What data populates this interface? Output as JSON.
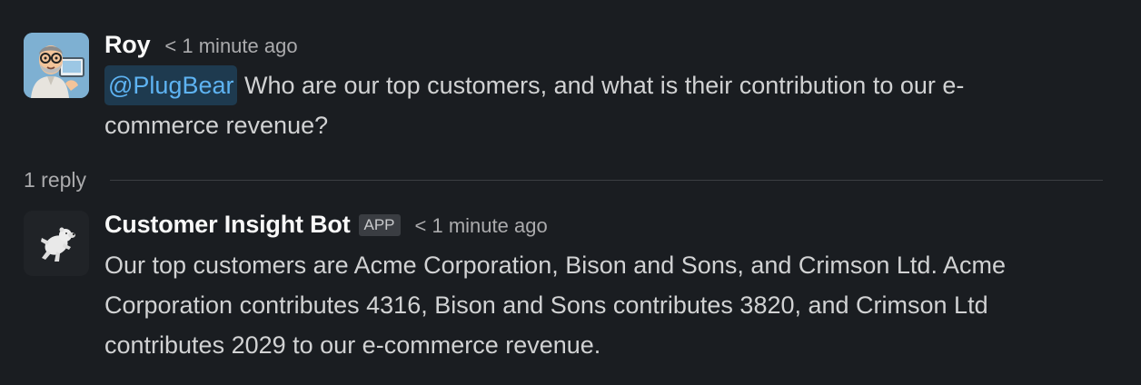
{
  "messages": [
    {
      "author": "Roy",
      "timestamp": "< 1 minute ago",
      "mention": "@PlugBear",
      "text_line1": " Who are our top customers, and what is their contribution to our e-",
      "text_line2": "commerce revenue?"
    },
    {
      "author": "Customer Insight Bot",
      "badge": "APP",
      "timestamp": "< 1 minute ago",
      "text_line1": "Our top customers are Acme Corporation, Bison and Sons, and Crimson Ltd. Acme",
      "text_line2": "Corporation contributes 4316, Bison and Sons contributes 3820, and Crimson Ltd",
      "text_line3": "contributes 2029 to our e-commerce revenue."
    }
  ],
  "replies": {
    "label": "1 reply"
  },
  "colors": {
    "background": "#1a1d21",
    "mention_bg": "#1e3a4f",
    "mention_text": "#5eb3f2",
    "divider": "#3b3e43"
  },
  "icons": {
    "roy_avatar": "cartoon-man-avatar",
    "bot_avatar": "polar-bear-avatar"
  }
}
